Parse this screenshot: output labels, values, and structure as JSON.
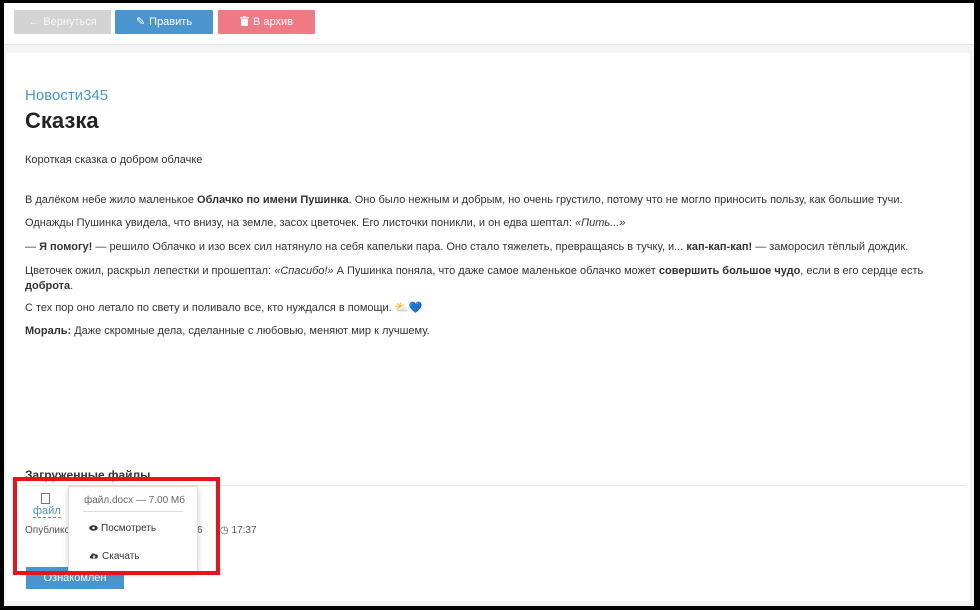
{
  "toolbar": {
    "back_label": "Вернуться",
    "edit_label": "Править",
    "archive_label": "В архив",
    "back_icon": "arrow-left-icon",
    "edit_icon": "pencil-icon",
    "archive_icon": "trash-icon"
  },
  "article": {
    "category": "Новости345",
    "title": "Сказка",
    "subtitle": "Короткая сказка о добром облачке",
    "p1": {
      "a": "В далёком небе жило маленькое ",
      "b": "Облачко по имени Пушинка",
      "c": ". Оно было нежным и добрым, но очень грустило, потому что не могло приносить пользу, как большие тучи."
    },
    "p2": {
      "a": "Однажды Пушинка увидела, что внизу, на земле, засох цветочек. Его листочки поникли, и он едва шептал: ",
      "b": "«Пить...»"
    },
    "p3": {
      "a": "— ",
      "b": "Я помогу!",
      "c": " — решило Облачко и изо всех сил натянуло на себя капельки пара. Оно стало тяжелеть, превращаясь в тучку, и... ",
      "d": "кап-кап-кап!",
      "e": " — заморосил тёплый дождик."
    },
    "p4": {
      "a": "Цветочек ожил, раскрыл лепестки и прошептал: ",
      "b": "«Спасибо!»",
      "c": " А Пушинка поняла, что даже самое маленькое облачко может ",
      "d": "совершить большое чудо",
      "e": ", если в его сердце есть ",
      "f": "доброта",
      "g": "."
    },
    "p5": {
      "a": "С тех пор оно летало по свету и поливало все, кто нуждался в помощи. ",
      "emoji": "⛅💙"
    },
    "p6": {
      "a": "Мораль:",
      "b": " Даже скромные дела, сделанные с любовью, меняют мир к лучшему."
    }
  },
  "files": {
    "heading": "Загруженные файлы",
    "file_link": "файл",
    "file_icon": "file-icon",
    "published_label": "Опублико",
    "published_tail": "6",
    "published_time": "17:37",
    "clock_icon": "clock-icon"
  },
  "ack_button": "Ознакомлен",
  "dropdown": {
    "header": "файл.docx — 7.00 Мб",
    "view_label": "Посмотреть",
    "download_label": "Скачать",
    "view_icon": "eye-icon",
    "download_icon": "cloud-download-icon"
  },
  "colors": {
    "primary": "#4a95cf",
    "danger": "#ef7a86",
    "disabled": "#d3d3d3",
    "highlight": "#e8141b"
  }
}
